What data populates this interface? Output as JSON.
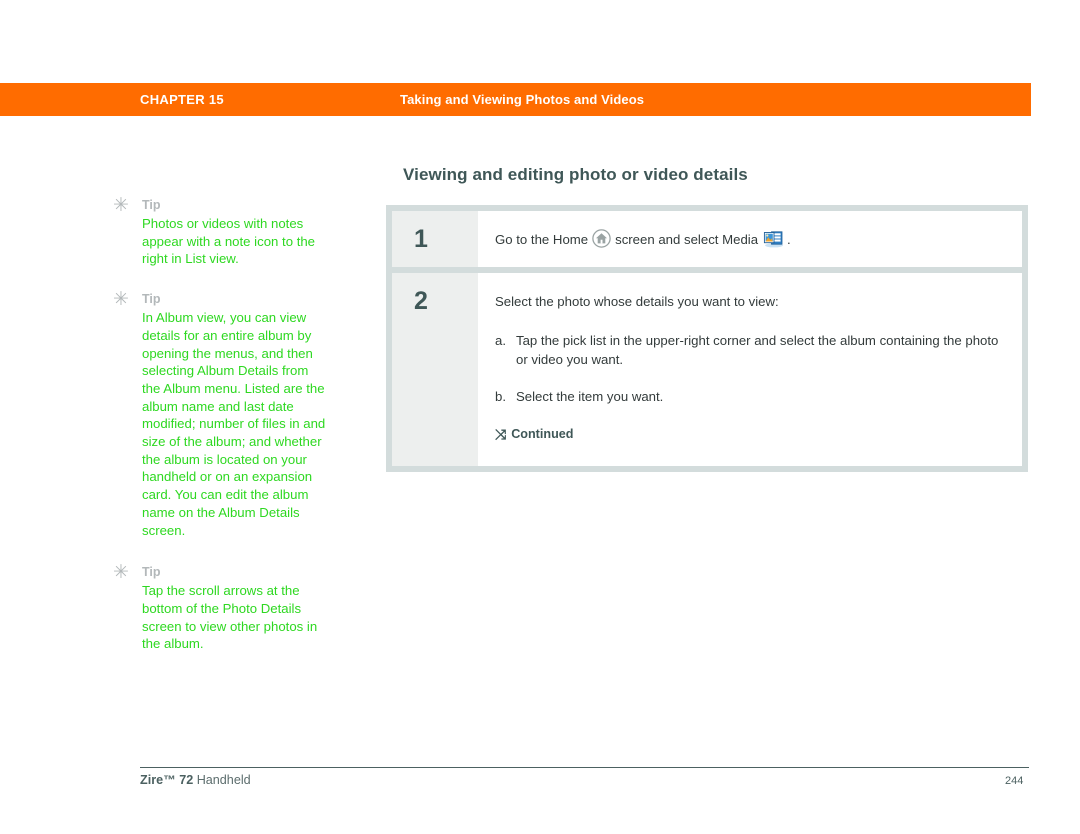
{
  "header": {
    "chapter": "CHAPTER 15",
    "title": "Taking and Viewing Photos and Videos",
    "bar_color": "#ff6c00"
  },
  "page": {
    "heading": "Viewing and editing photo or video details"
  },
  "sidebar": {
    "tips": [
      {
        "icon": "asterisk-icon",
        "label": "Tip",
        "text": "Photos or videos with notes appear with a note icon to the right in List view."
      },
      {
        "icon": "asterisk-icon",
        "label": "Tip",
        "text": "In Album view, you can view details for an entire album by opening the menus, and then selecting Album Details from the Album menu. Listed are the album name and last date modified; number of files in and size of the album; and whether the album is located on your handheld or on an expansion card. You can edit the album name on the Album Details screen."
      },
      {
        "icon": "asterisk-icon",
        "label": "Tip",
        "text": "Tap the scroll arrows at the bottom of the Photo Details screen to view other photos in the album."
      }
    ],
    "tip_text_color": "#2ed821",
    "tip_label_color": "#b3b8ba"
  },
  "steps": [
    {
      "number": "1",
      "text_before_home": "Go to the Home",
      "home_icon": "home-icon",
      "text_middle": "screen and select Media",
      "media_icon": "media-app-icon",
      "text_after": "."
    },
    {
      "number": "2",
      "intro": "Select the photo whose details you want to view:",
      "sub_items": [
        {
          "marker": "a.",
          "text": "Tap the pick list in the upper-right corner and select the album containing the photo or video you want."
        },
        {
          "marker": "b.",
          "text": "Select the item you want."
        }
      ],
      "continued_arrow": "arrow-down-right-icon",
      "continued_label": "Continued"
    }
  ],
  "footer": {
    "product_bold": "Zire™ 72",
    "product_rest": "Handheld",
    "page_number": "244"
  }
}
